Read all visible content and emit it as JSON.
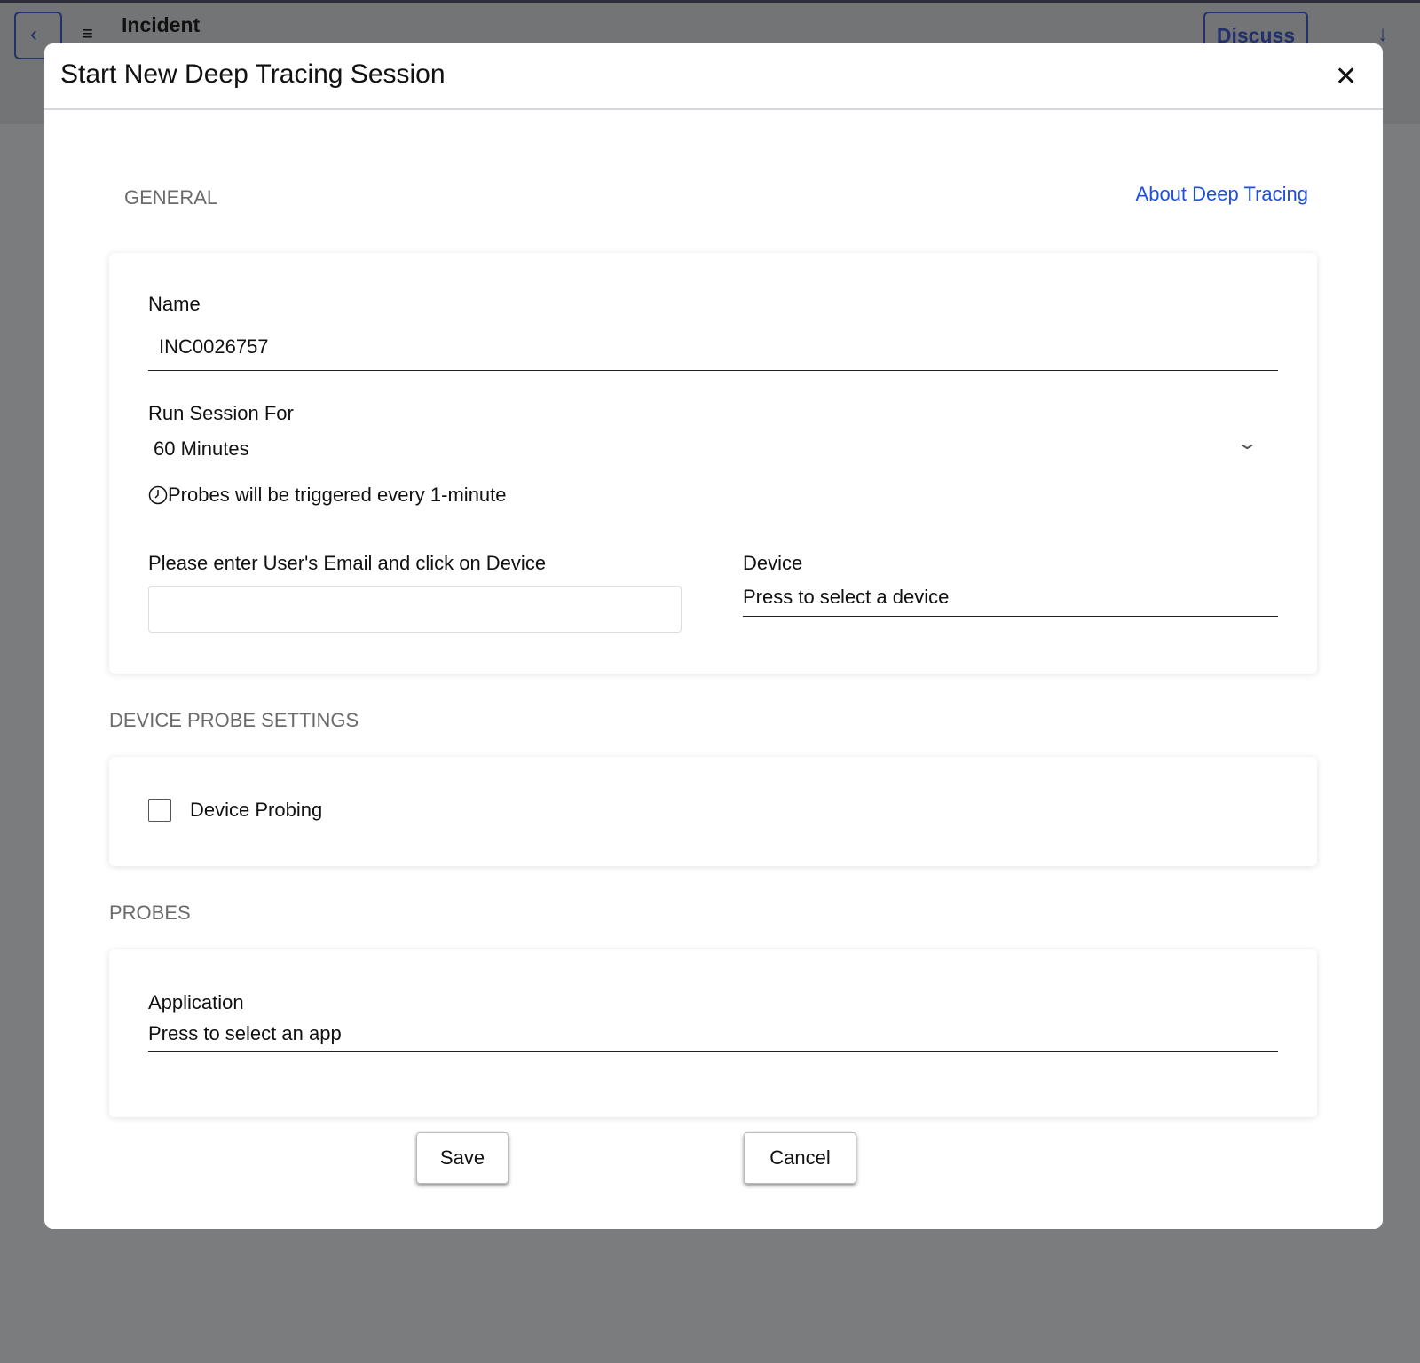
{
  "background": {
    "header_title": "Incident",
    "discuss_label": "Discuss"
  },
  "modal": {
    "title": "Start New Deep Tracing Session",
    "general_heading": "GENERAL",
    "about_link": "About Deep Tracing",
    "name_label": "Name",
    "name_value": "INC0026757",
    "run_label": "Run Session For",
    "run_value": "60 Minutes",
    "probe_note": "Probes will be triggered every 1-minute",
    "email_label": "Please enter User's Email and click on Device",
    "email_value": "",
    "device_label": "Device",
    "device_placeholder": "Press to select a device",
    "probe_settings_heading": "DEVICE PROBE SETTINGS",
    "device_probing_label": "Device Probing",
    "device_probing_checked": false,
    "probes_heading": "PROBES",
    "application_label": "Application",
    "application_placeholder": "Press to select an app",
    "save_label": "Save",
    "cancel_label": "Cancel"
  },
  "colors": {
    "link": "#1f4fe0",
    "overlay": "#7b7c7e"
  }
}
